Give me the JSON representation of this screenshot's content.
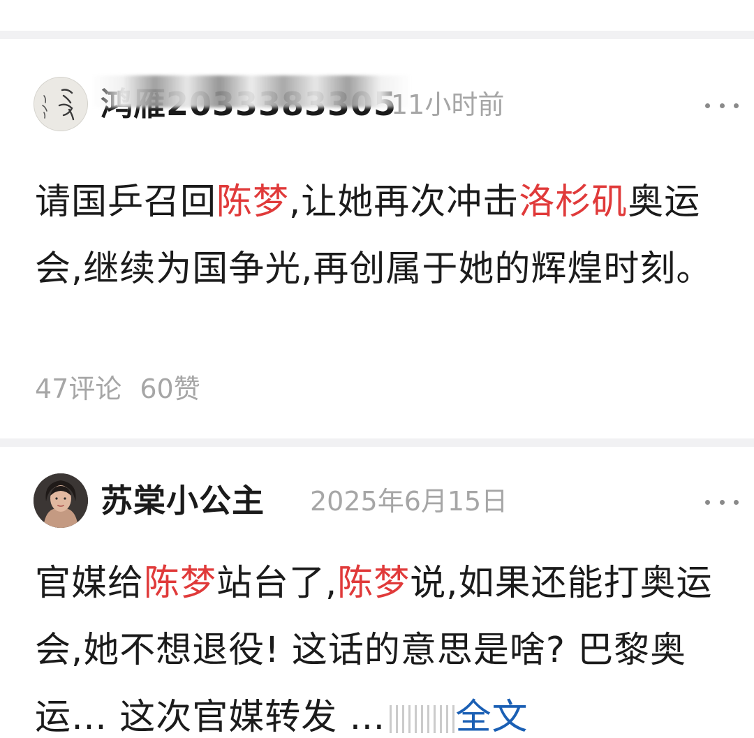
{
  "posts": [
    {
      "username": "鸿雁2033383305",
      "timestamp": "11小时前",
      "content_parts": [
        {
          "text": "请国乒召回",
          "highlight": false
        },
        {
          "text": "陈梦",
          "highlight": true
        },
        {
          "text": ",让她再次冲击",
          "highlight": false
        },
        {
          "text": "洛杉矶",
          "highlight": true
        },
        {
          "text": "奥运会,继续为国争光,再创属于她的辉煌时刻。",
          "highlight": false
        }
      ],
      "comments": "47评论",
      "likes": "60赞"
    },
    {
      "username": "苏棠小公主",
      "timestamp": "2025年6月15日",
      "content_parts": [
        {
          "text": "官媒给",
          "highlight": false
        },
        {
          "text": "陈梦",
          "highlight": true
        },
        {
          "text": "站台了,",
          "highlight": false
        },
        {
          "text": "陈梦",
          "highlight": true
        },
        {
          "text": "说,如果还能打奥运会,她不想退役! 这话的意思是啥? 巴黎奥运… 这次官媒转发 …",
          "highlight": false
        }
      ],
      "full_text_label": "全文"
    }
  ],
  "colors": {
    "highlight": "#e03a3a",
    "link": "#1a5fb4",
    "muted": "#a6a6a6"
  },
  "icons": {
    "more": "more-horizontal-icon"
  }
}
